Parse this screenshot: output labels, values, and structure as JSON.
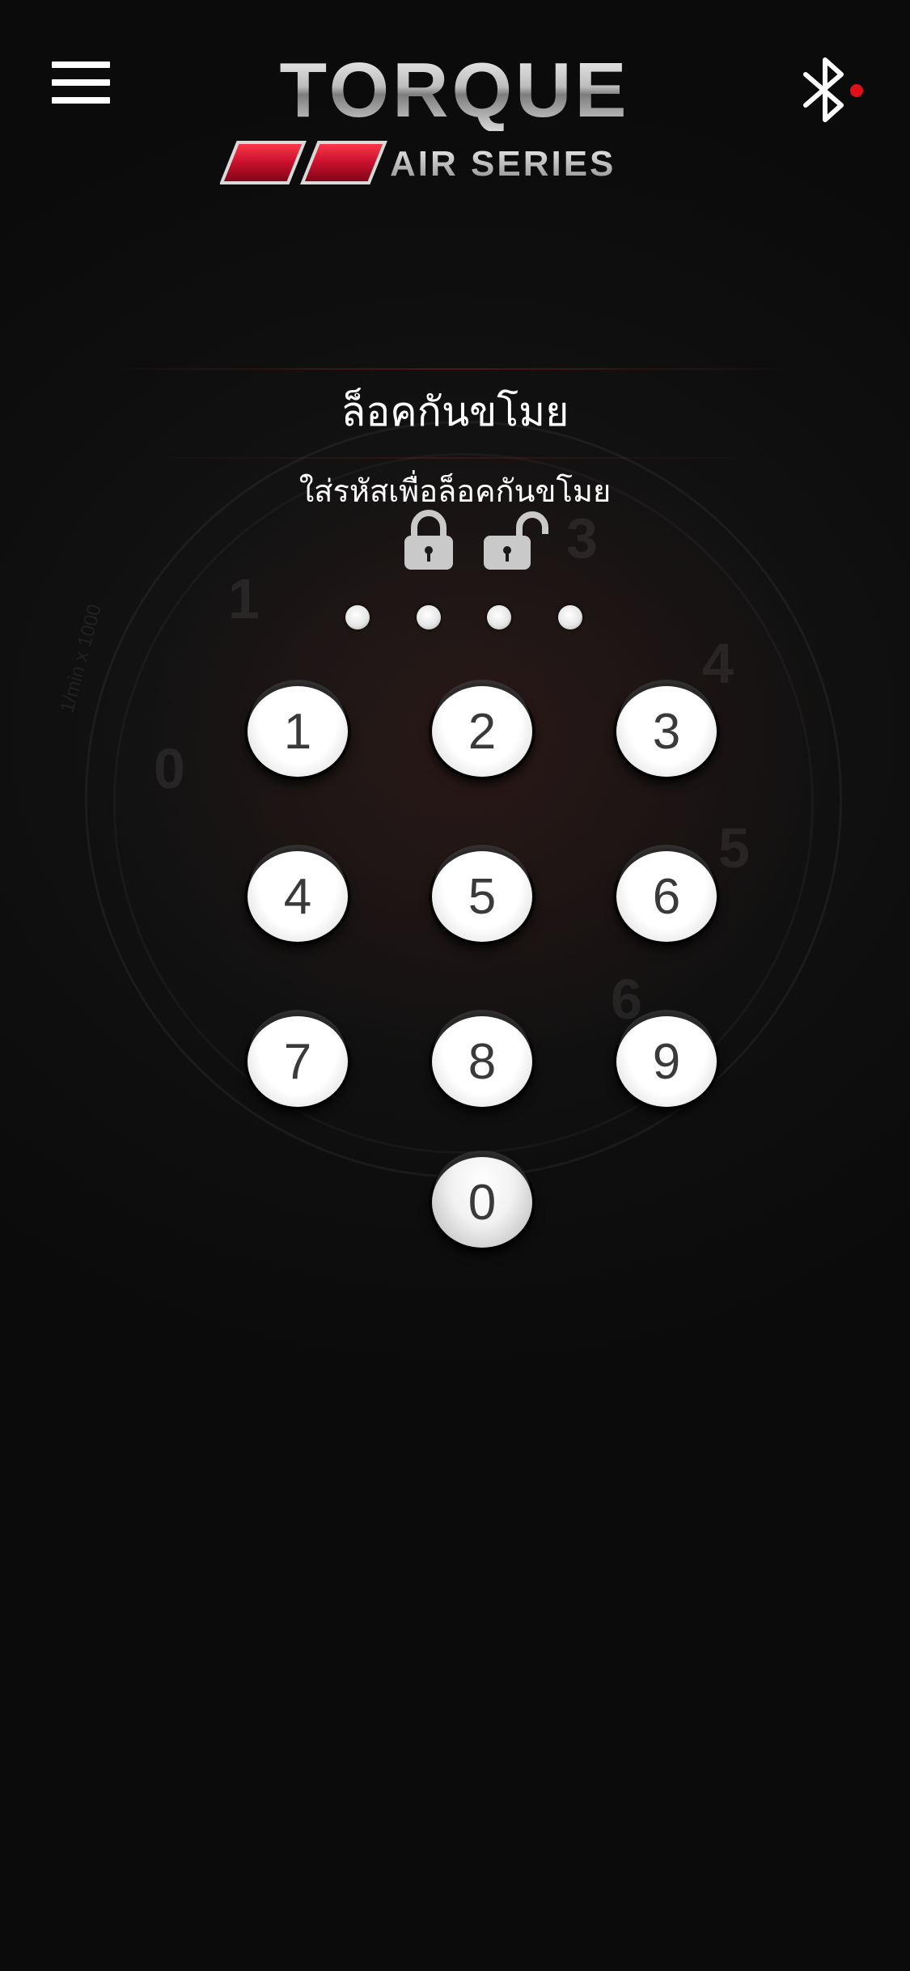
{
  "header": {
    "logo_title": "TORQUE",
    "logo_subtitle": "AIR SERIES",
    "bluetooth_status_color": "#e0101a"
  },
  "lock": {
    "title": "ล็อคกันขโมย",
    "subtitle": "ใส่รหัสเพื่อล็อคกันขโมย",
    "pin_length": 4
  },
  "background_gauge": {
    "numbers": [
      "0",
      "1",
      "3",
      "4",
      "5",
      "6"
    ],
    "unit_label": "1/min x 1000"
  },
  "keypad": {
    "keys": [
      "1",
      "2",
      "3",
      "4",
      "5",
      "6",
      "7",
      "8",
      "9",
      "0"
    ]
  },
  "colors": {
    "background": "#0b0b0b",
    "accent_red": "#c8102e",
    "key_face": "#ffffff",
    "key_text": "#3a3a3a"
  }
}
